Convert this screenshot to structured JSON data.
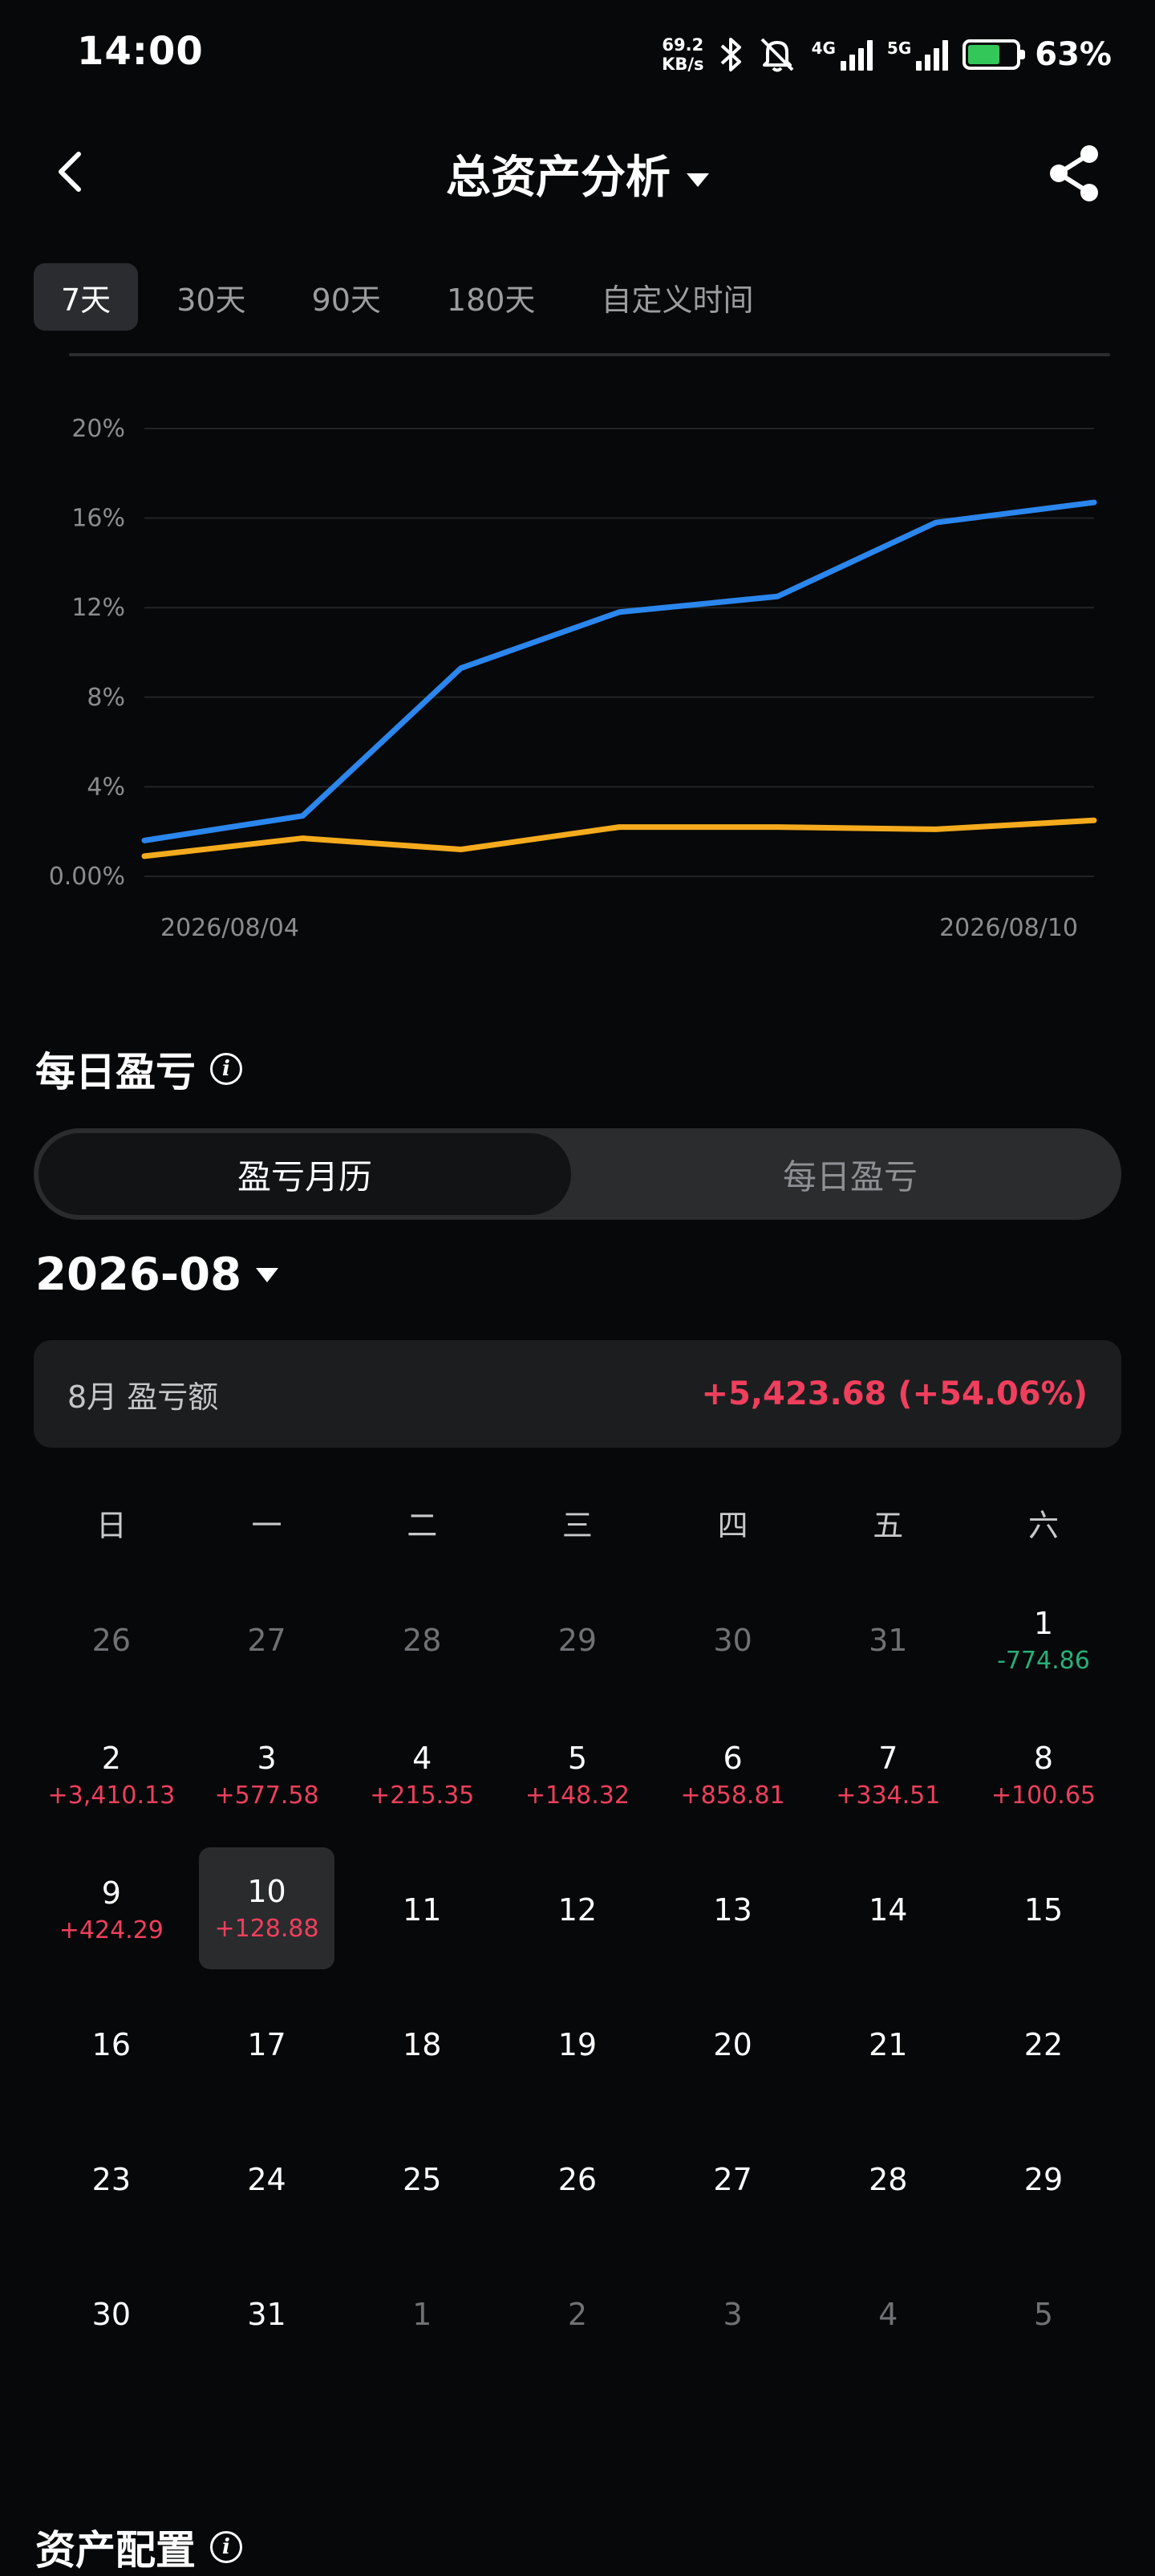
{
  "status_bar": {
    "time": "14:00",
    "net_speed_value": "69.2",
    "net_speed_unit": "KB/s",
    "signal1_label": "4G",
    "signal2_label": "5G",
    "battery": "63%",
    "colors": {
      "battery_fill": "#33c759"
    }
  },
  "header": {
    "back_icon": "chevron-left-icon",
    "title": "总资产分析",
    "share_icon": "share-icon"
  },
  "range_tabs": [
    {
      "label": "7天",
      "active": true
    },
    {
      "label": "30天",
      "active": false
    },
    {
      "label": "90天",
      "active": false
    },
    {
      "label": "180天",
      "active": false
    },
    {
      "label": "自定义时间",
      "active": false
    }
  ],
  "chart_data": {
    "type": "line",
    "x": [
      "2026/08/04",
      "2026/08/05",
      "2026/08/06",
      "2026/08/07",
      "2026/08/08",
      "2026/08/09",
      "2026/08/10"
    ],
    "series": [
      {
        "color": "#2b86ee",
        "values": [
          1.6,
          2.7,
          9.3,
          11.8,
          12.5,
          15.8,
          16.7
        ]
      },
      {
        "color": "#f5ab1d",
        "values": [
          0.9,
          1.7,
          1.2,
          2.2,
          2.2,
          2.1,
          2.5
        ]
      }
    ],
    "y_ticks": [
      "0.00%",
      "4%",
      "8%",
      "12%",
      "16%",
      "20%"
    ],
    "x_tick_labels": [
      "2026/08/04",
      "2026/08/10"
    ],
    "ylim": [
      0,
      20
    ],
    "grid": true,
    "y_unit": "%"
  },
  "daily_pnl": {
    "title": "每日盈亏",
    "info_icon": "info-icon",
    "segments": [
      {
        "label": "盈亏月历",
        "active": true
      },
      {
        "label": "每日盈亏",
        "active": false
      }
    ],
    "month_selector": "2026-08",
    "summary_label": "8月 盈亏额",
    "summary_value": "+5,423.68 (+54.06%)",
    "colors": {
      "profit": "#ef3f5d",
      "loss": "#25b07a"
    },
    "weekdays": [
      "日",
      "一",
      "二",
      "三",
      "四",
      "五",
      "六"
    ],
    "days": [
      {
        "day": "26",
        "pnl": "",
        "muted": true,
        "today": false
      },
      {
        "day": "27",
        "pnl": "",
        "muted": true,
        "today": false
      },
      {
        "day": "28",
        "pnl": "",
        "muted": true,
        "today": false
      },
      {
        "day": "29",
        "pnl": "",
        "muted": true,
        "today": false
      },
      {
        "day": "30",
        "pnl": "",
        "muted": true,
        "today": false
      },
      {
        "day": "31",
        "pnl": "",
        "muted": true,
        "today": false
      },
      {
        "day": "1",
        "pnl": "-774.86",
        "muted": false,
        "today": false
      },
      {
        "day": "2",
        "pnl": "+3,410.13",
        "muted": false,
        "today": false
      },
      {
        "day": "3",
        "pnl": "+577.58",
        "muted": false,
        "today": false
      },
      {
        "day": "4",
        "pnl": "+215.35",
        "muted": false,
        "today": false
      },
      {
        "day": "5",
        "pnl": "+148.32",
        "muted": false,
        "today": false
      },
      {
        "day": "6",
        "pnl": "+858.81",
        "muted": false,
        "today": false
      },
      {
        "day": "7",
        "pnl": "+334.51",
        "muted": false,
        "today": false
      },
      {
        "day": "8",
        "pnl": "+100.65",
        "muted": false,
        "today": false
      },
      {
        "day": "9",
        "pnl": "+424.29",
        "muted": false,
        "today": false
      },
      {
        "day": "10",
        "pnl": "+128.88",
        "muted": false,
        "today": true
      },
      {
        "day": "11",
        "pnl": "",
        "muted": false,
        "today": false
      },
      {
        "day": "12",
        "pnl": "",
        "muted": false,
        "today": false
      },
      {
        "day": "13",
        "pnl": "",
        "muted": false,
        "today": false
      },
      {
        "day": "14",
        "pnl": "",
        "muted": false,
        "today": false
      },
      {
        "day": "15",
        "pnl": "",
        "muted": false,
        "today": false
      },
      {
        "day": "16",
        "pnl": "",
        "muted": false,
        "today": false
      },
      {
        "day": "17",
        "pnl": "",
        "muted": false,
        "today": false
      },
      {
        "day": "18",
        "pnl": "",
        "muted": false,
        "today": false
      },
      {
        "day": "19",
        "pnl": "",
        "muted": false,
        "today": false
      },
      {
        "day": "20",
        "pnl": "",
        "muted": false,
        "today": false
      },
      {
        "day": "21",
        "pnl": "",
        "muted": false,
        "today": false
      },
      {
        "day": "22",
        "pnl": "",
        "muted": false,
        "today": false
      },
      {
        "day": "23",
        "pnl": "",
        "muted": false,
        "today": false
      },
      {
        "day": "24",
        "pnl": "",
        "muted": false,
        "today": false
      },
      {
        "day": "25",
        "pnl": "",
        "muted": false,
        "today": false
      },
      {
        "day": "26",
        "pnl": "",
        "muted": false,
        "today": false
      },
      {
        "day": "27",
        "pnl": "",
        "muted": false,
        "today": false
      },
      {
        "day": "28",
        "pnl": "",
        "muted": false,
        "today": false
      },
      {
        "day": "29",
        "pnl": "",
        "muted": false,
        "today": false
      },
      {
        "day": "30",
        "pnl": "",
        "muted": false,
        "today": false
      },
      {
        "day": "31",
        "pnl": "",
        "muted": false,
        "today": false
      },
      {
        "day": "1",
        "pnl": "",
        "muted": true,
        "today": false
      },
      {
        "day": "2",
        "pnl": "",
        "muted": true,
        "today": false
      },
      {
        "day": "3",
        "pnl": "",
        "muted": true,
        "today": false
      },
      {
        "day": "4",
        "pnl": "",
        "muted": true,
        "today": false
      },
      {
        "day": "5",
        "pnl": "",
        "muted": true,
        "today": false
      }
    ]
  },
  "asset_allocation": {
    "title": "资产配置",
    "info_icon": "info-icon"
  }
}
